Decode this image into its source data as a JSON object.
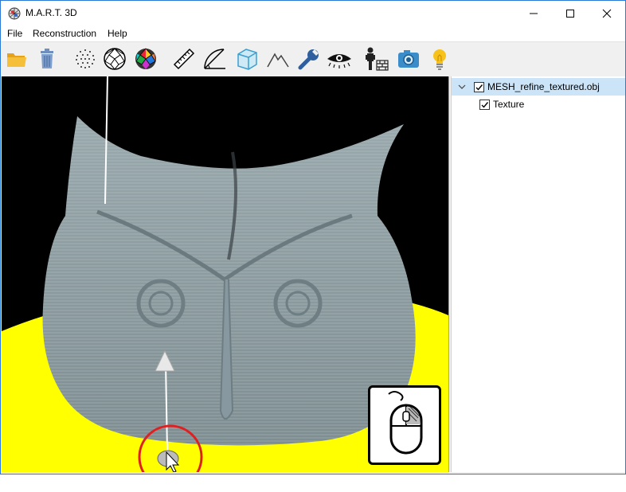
{
  "window": {
    "title": "M.A.R.T. 3D",
    "controls": {
      "minimize": "minimize-icon",
      "maximize": "maximize-icon",
      "close": "close-icon"
    }
  },
  "menu": [
    "File",
    "Reconstruction",
    "Help"
  ],
  "toolbar": {
    "tools": [
      {
        "name": "open-folder-icon"
      },
      {
        "name": "trash-icon"
      },
      {
        "name": "point-cloud-icon"
      },
      {
        "name": "wireframe-sphere-icon"
      },
      {
        "name": "colored-sphere-icon"
      },
      {
        "name": "ruler-icon"
      },
      {
        "name": "protractor-icon"
      },
      {
        "name": "cube-icon"
      },
      {
        "name": "terrain-icon"
      },
      {
        "name": "wrench-icon"
      },
      {
        "name": "eye-icon"
      },
      {
        "name": "scale-figure-icon"
      },
      {
        "name": "camera-icon"
      },
      {
        "name": "lightbulb-icon"
      }
    ]
  },
  "tree": {
    "root": {
      "label": "MESH_refine_textured.obj",
      "checked": true,
      "expanded": true
    },
    "children": [
      {
        "label": "Texture",
        "checked": true
      }
    ]
  },
  "viewport": {
    "background": "#000000",
    "floor_color": "#ffff00",
    "model_color": "#8a9aa0",
    "highlight_color": "#e02020",
    "mouse_hint": "mouse-icon"
  }
}
